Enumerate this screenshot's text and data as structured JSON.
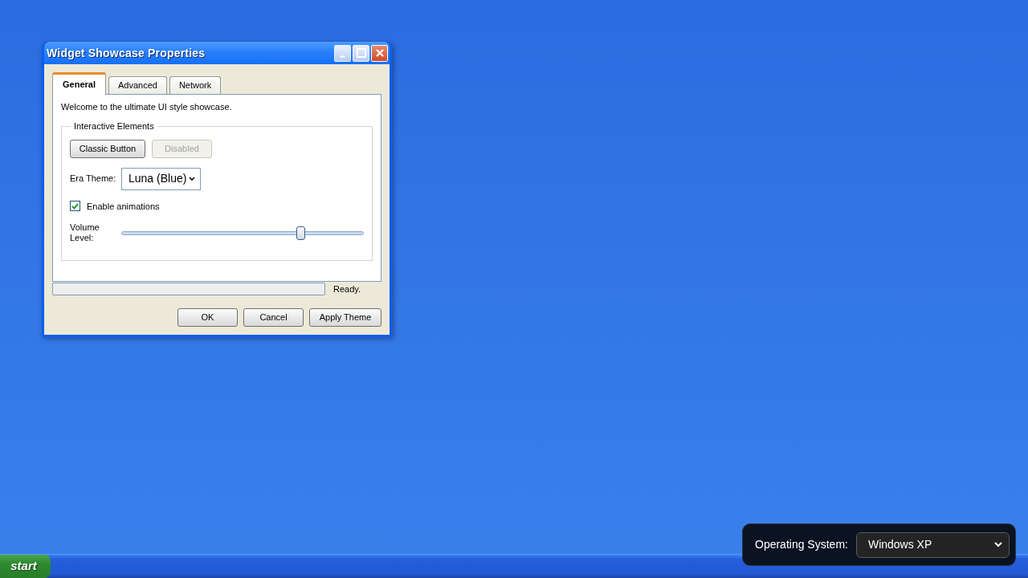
{
  "window": {
    "title": "Widget Showcase Properties"
  },
  "tabs": [
    {
      "label": "General",
      "selected": true
    },
    {
      "label": "Advanced",
      "selected": false
    },
    {
      "label": "Network",
      "selected": false
    }
  ],
  "panel": {
    "intro": "Welcome to the ultimate UI style showcase.",
    "group": {
      "legend": "Interactive Elements",
      "buttons": [
        {
          "label": "Classic Button",
          "disabled": false
        },
        {
          "label": "Disabled",
          "disabled": true
        }
      ],
      "theme": {
        "label": "Era Theme:",
        "value": "Luna (Blue)"
      },
      "animations": {
        "label": "Enable animations",
        "checked": true
      },
      "volume": {
        "label": "Volume Level:",
        "level": 0.74
      }
    }
  },
  "status": {
    "progress": {
      "level": 0
    },
    "text": "Ready."
  },
  "buttons": [
    {
      "label": "OK"
    },
    {
      "label": "Cancel"
    },
    {
      "label": "Apply Theme"
    }
  ],
  "taskbar": {
    "start": "start"
  },
  "os_picker": {
    "label": "Operating System:",
    "value": "Windows XP"
  }
}
